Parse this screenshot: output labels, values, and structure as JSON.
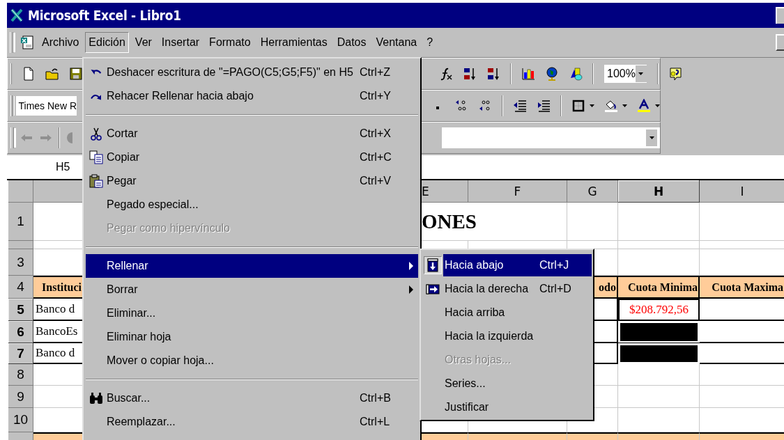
{
  "window": {
    "title": "Microsoft Excel - Libro1"
  },
  "menu_bar": [
    {
      "label": "Archivo",
      "selected": false
    },
    {
      "label": "Edición",
      "selected": true
    },
    {
      "label": "Ver",
      "selected": false
    },
    {
      "label": "Insertar",
      "selected": false
    },
    {
      "label": "Formato",
      "selected": false
    },
    {
      "label": "Herramientas",
      "selected": false
    },
    {
      "label": "Datos",
      "selected": false
    },
    {
      "label": "Ventana",
      "selected": false
    },
    {
      "label": "?",
      "selected": false
    }
  ],
  "standard_toolbar": {
    "zoom": "100%"
  },
  "formatting_toolbar": {
    "font": "Times New R"
  },
  "name_box": "H5",
  "sheet": {
    "columns": [
      {
        "selected": false
      },
      {
        "label": "E",
        "selected": false
      },
      {
        "label": "F",
        "selected": false
      },
      {
        "label": "G",
        "selected": false
      },
      {
        "label": "H",
        "selected": true
      },
      {
        "label": "I",
        "selected": false
      }
    ],
    "rows": [
      {
        "label": "1",
        "selected": false,
        "cells": [
          "",
          {
            "kind": "title",
            "text": "ONES"
          },
          null,
          "",
          "",
          ""
        ]
      },
      {
        "selected": false,
        "cells": [
          "",
          "",
          "",
          "",
          "",
          ""
        ]
      },
      {
        "label": "3",
        "selected": false,
        "cells": [
          "",
          null,
          null,
          "",
          "",
          ""
        ]
      },
      {
        "label": "4",
        "selected": false,
        "cells": [
          {
            "kind": "header",
            "text": "Instituci"
          },
          null,
          null,
          {
            "kind": "header",
            "text": "odo"
          },
          {
            "kind": "header",
            "text": "Cuota Minima"
          },
          {
            "kind": "header",
            "text": "Cuota Maxima"
          }
        ]
      },
      {
        "label": "5",
        "selected": true,
        "cells": [
          {
            "kind": "text",
            "text": "Banco d"
          },
          null,
          null,
          {
            "kind": "boxed"
          },
          {
            "kind": "amount",
            "text": "$208.792,56"
          },
          {
            "kind": "boxed"
          }
        ]
      },
      {
        "label": "6",
        "selected": true,
        "cells": [
          {
            "kind": "text",
            "text": "BancoEs"
          },
          null,
          null,
          {
            "kind": "boxed"
          },
          {
            "kind": "selected"
          },
          {
            "kind": "boxed"
          }
        ]
      },
      {
        "label": "7",
        "selected": true,
        "cells": [
          {
            "kind": "text",
            "text": "Banco d"
          },
          null,
          null,
          {
            "kind": "boxed"
          },
          {
            "kind": "selected"
          },
          {
            "kind": "boxed"
          }
        ]
      },
      {
        "label": "8",
        "selected": false,
        "cells": [
          "",
          null,
          null,
          "",
          "",
          ""
        ]
      },
      {
        "label": "9",
        "selected": false,
        "cells": [
          "",
          null,
          null,
          "",
          "",
          ""
        ]
      },
      {
        "label": "10",
        "selected": false,
        "cells": [
          "",
          "",
          "",
          "",
          "",
          ""
        ]
      },
      {
        "selected": false,
        "cells": [
          {
            "kind": "band"
          },
          {
            "kind": "band"
          },
          {
            "kind": "band"
          },
          {
            "kind": "band"
          },
          {
            "kind": "band"
          },
          {
            "kind": "band"
          }
        ]
      }
    ]
  },
  "edit_menu": [
    {
      "kind": "item",
      "label": "Deshacer escritura de \"=PAGO(C5;G5;F5)\" en H5",
      "shortcut": "Ctrl+Z",
      "disabled": false,
      "selected": false,
      "submenu": false
    },
    {
      "kind": "item",
      "label": "Rehacer Rellenar hacia abajo",
      "shortcut": "Ctrl+Y",
      "disabled": false,
      "selected": false,
      "submenu": false
    },
    {
      "kind": "separator"
    },
    {
      "kind": "item",
      "label": "Cortar",
      "shortcut": "Ctrl+X",
      "disabled": false,
      "selected": false,
      "submenu": false
    },
    {
      "kind": "item",
      "label": "Copiar",
      "shortcut": "Ctrl+C",
      "disabled": false,
      "selected": false,
      "submenu": false
    },
    {
      "kind": "item",
      "label": "Pegar",
      "shortcut": "Ctrl+V",
      "disabled": false,
      "selected": false,
      "submenu": false
    },
    {
      "kind": "item",
      "label": "Pegado especial...",
      "disabled": false,
      "selected": false,
      "submenu": false
    },
    {
      "kind": "item",
      "label": "Pegar como hipervínculo",
      "disabled": true,
      "selected": false,
      "submenu": false
    },
    {
      "kind": "separator"
    },
    {
      "kind": "item",
      "label": "Rellenar",
      "disabled": false,
      "selected": true,
      "submenu": true
    },
    {
      "kind": "item",
      "label": "Borrar",
      "disabled": false,
      "selected": false,
      "submenu": true
    },
    {
      "kind": "item",
      "label": "Eliminar...",
      "disabled": false,
      "selected": false,
      "submenu": false
    },
    {
      "kind": "item",
      "label": "Eliminar hoja",
      "disabled": false,
      "selected": false,
      "submenu": false
    },
    {
      "kind": "item",
      "label": "Mover o copiar hoja...",
      "disabled": false,
      "selected": false,
      "submenu": false
    },
    {
      "kind": "separator"
    },
    {
      "kind": "item",
      "label": "Buscar...",
      "shortcut": "Ctrl+B",
      "disabled": false,
      "selected": false,
      "submenu": false
    },
    {
      "kind": "item",
      "label": "Reemplazar...",
      "shortcut": "Ctrl+L",
      "disabled": false,
      "selected": false,
      "submenu": false
    }
  ],
  "fill_submenu": [
    {
      "label": "Hacia abajo",
      "shortcut": "Ctrl+J",
      "disabled": false,
      "selected": true
    },
    {
      "label": "Hacia la derecha",
      "shortcut": "Ctrl+D",
      "disabled": false,
      "selected": false
    },
    {
      "label": "Hacia arriba",
      "disabled": false,
      "selected": false
    },
    {
      "label": "Hacia la izquierda",
      "disabled": false,
      "selected": false
    },
    {
      "label": "Otras hojas...",
      "disabled": true,
      "selected": false
    },
    {
      "label": "Series...",
      "disabled": false,
      "selected": false
    },
    {
      "label": "Justificar",
      "disabled": false,
      "selected": false
    }
  ]
}
